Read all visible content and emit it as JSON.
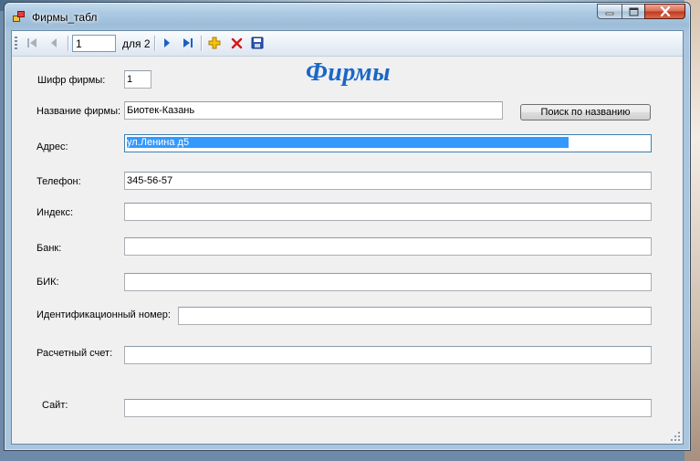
{
  "window": {
    "title": "Фирмы_табл"
  },
  "navigator": {
    "position_value": "1",
    "count_label": "для 2"
  },
  "form": {
    "heading": "Фирмы",
    "search_button_label": "Поиск по названию",
    "fields": {
      "code": {
        "label": "Шифр фирмы:",
        "value": "1"
      },
      "name": {
        "label": "Название фирмы:",
        "value": "Биотек-Казань"
      },
      "address": {
        "label": "Адрес:",
        "value": "ул.Ленина д5"
      },
      "phone": {
        "label": "Телефон:",
        "value": "345-56-57"
      },
      "index": {
        "label": "Индекс:",
        "value": ""
      },
      "bank": {
        "label": "Банк:",
        "value": ""
      },
      "bik": {
        "label": "БИК:",
        "value": ""
      },
      "inn": {
        "label": "Идентификационный номер:",
        "value": ""
      },
      "account": {
        "label": "Расчетный счет:",
        "value": ""
      },
      "site": {
        "label": "Сайт:",
        "value": ""
      }
    }
  },
  "colors": {
    "heading": "#1a68c8",
    "selection": "#3399ff",
    "delete_icon": "#d01818",
    "add_icon": "#e8a800"
  },
  "icons": {
    "move_first": "move-first-icon",
    "move_previous": "move-previous-icon",
    "move_next": "move-next-icon",
    "move_last": "move-last-icon",
    "add": "add-new-icon",
    "delete": "delete-icon",
    "save": "save-icon"
  }
}
